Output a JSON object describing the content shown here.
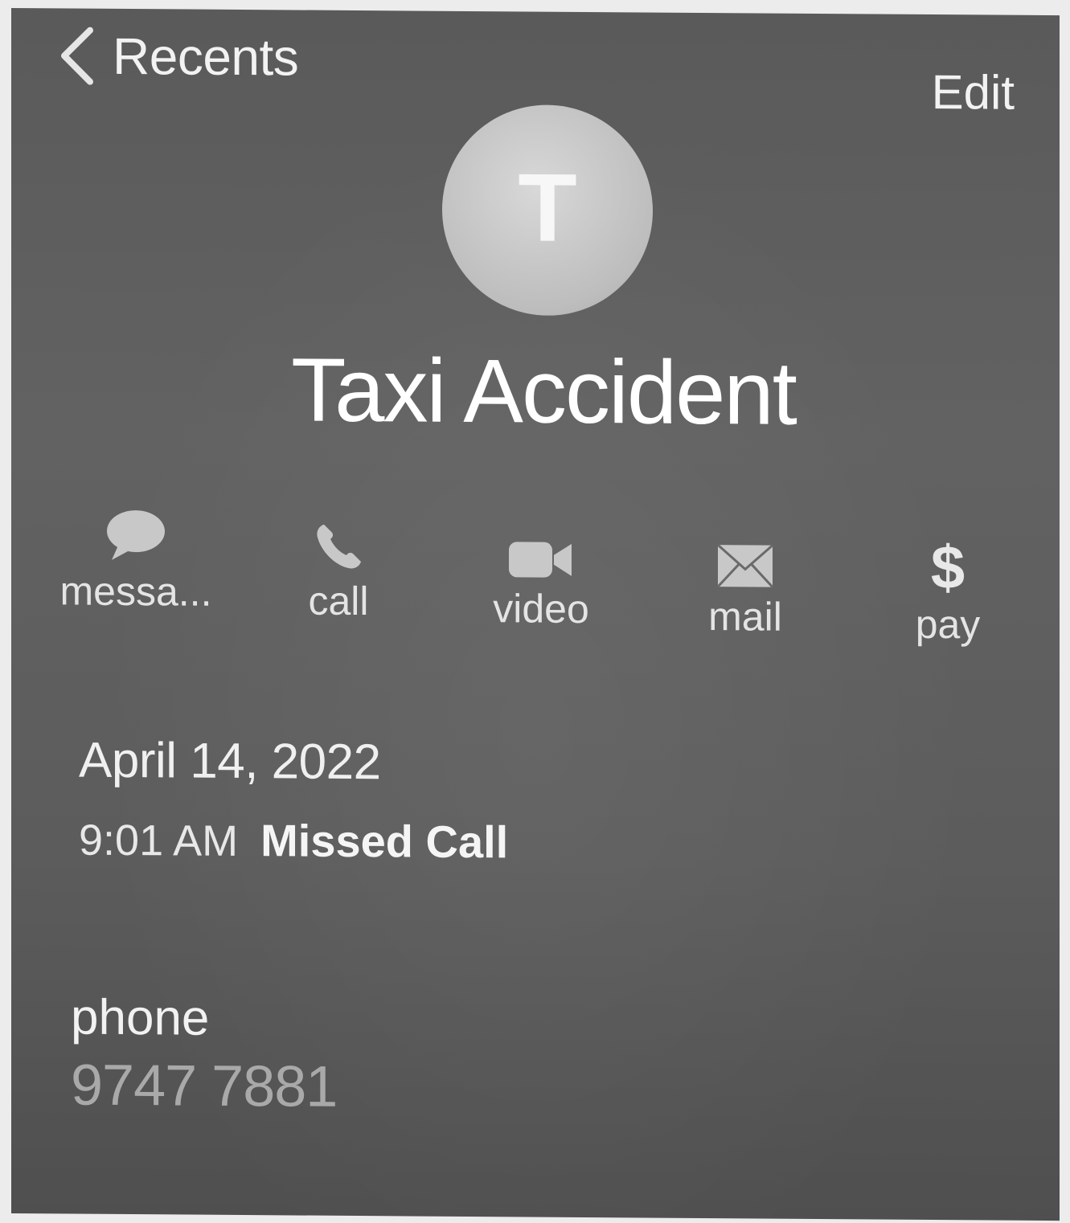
{
  "nav": {
    "back_label": "Recents",
    "edit_label": "Edit"
  },
  "contact": {
    "initial": "T",
    "name": "Taxi Accident"
  },
  "actions": [
    {
      "label": "messa...",
      "icon": "message-bubble-icon"
    },
    {
      "label": "call",
      "icon": "phone-icon"
    },
    {
      "label": "video",
      "icon": "video-camera-icon"
    },
    {
      "label": "mail",
      "icon": "envelope-icon"
    },
    {
      "label": "pay",
      "icon": "dollar-icon"
    }
  ],
  "call_log": {
    "date": "April 14, 2022",
    "time": "9:01 AM",
    "status": "Missed Call"
  },
  "phone": {
    "label": "phone",
    "number": "9747 7881"
  },
  "colors": {
    "screen_bg": "#5e5e5e",
    "text_primary": "#f2f2f2",
    "text_secondary": "#a9a9a9",
    "avatar_bg": "#c4c4c4",
    "icon_fill": "#c8c8c8"
  }
}
